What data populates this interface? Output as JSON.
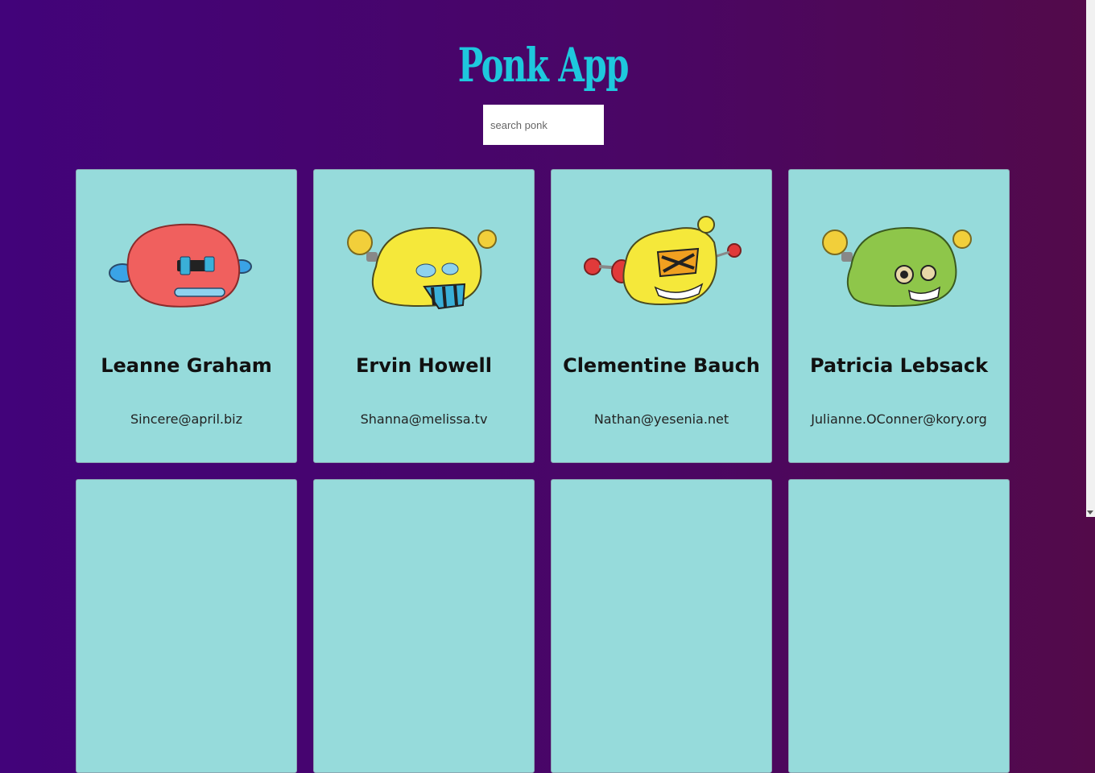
{
  "app": {
    "title": "Ponk App"
  },
  "search": {
    "placeholder": "search ponk"
  },
  "cards": [
    {
      "name": "Leanne Graham",
      "email": "Sincere@april.biz",
      "robot_color": "#f0605e"
    },
    {
      "name": "Ervin Howell",
      "email": "Shanna@melissa.tv",
      "robot_color": "#f5e83a"
    },
    {
      "name": "Clementine Bauch",
      "email": "Nathan@yesenia.net",
      "robot_color": "#f5e83a"
    },
    {
      "name": "Patricia Lebsack",
      "email": "Julianne.OConner@kory.org",
      "robot_color": "#8ec64a"
    },
    {
      "name": "",
      "email": ""
    },
    {
      "name": "",
      "email": ""
    },
    {
      "name": "",
      "email": ""
    },
    {
      "name": "",
      "email": ""
    }
  ],
  "colors": {
    "card_bg": "#96dbdb",
    "title": "#1ec8dd"
  }
}
